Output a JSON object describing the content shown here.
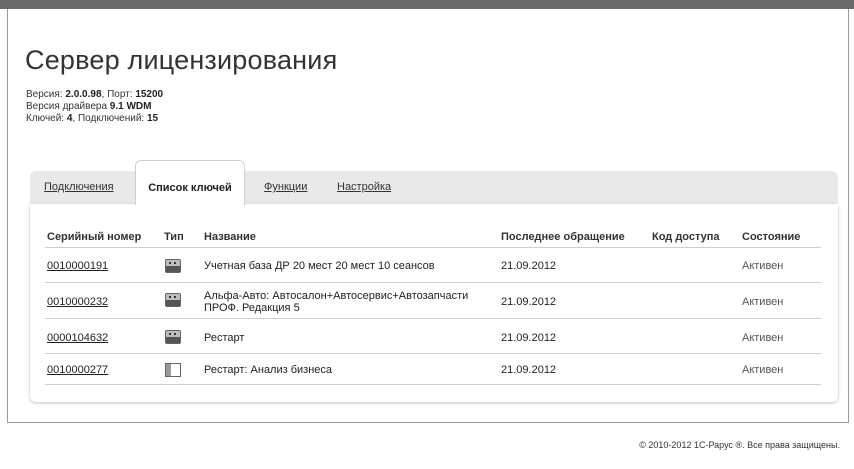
{
  "header": {
    "title": "Сервер лицензирования",
    "version_label": "Версия:",
    "version": "2.0.0.98",
    "port_label": ", Порт:",
    "port": "15200",
    "driver_label": "Версия драйвера",
    "driver": "9.1 WDM",
    "keys_label": "Ключей:",
    "keys": "4",
    "connections_label": ", Подключений:",
    "connections": "15"
  },
  "tabs": [
    {
      "label": "Подключения",
      "active": false
    },
    {
      "label": "Список ключей",
      "active": true
    },
    {
      "label": "Функции",
      "active": false
    },
    {
      "label": "Настройка",
      "active": false
    }
  ],
  "table": {
    "headers": [
      "Серийный номер",
      "Тип",
      "Название",
      "Последнее обращение",
      "Код доступа",
      "Состояние"
    ],
    "rows": [
      {
        "serial": "0010000191",
        "type_icon": "usb-key-icon",
        "name": "Учетная база ДР 20 мест 20 мест 10 сеансов",
        "name_line2": "",
        "last_access": "21.09.2012",
        "access_code": "",
        "status": "Активен"
      },
      {
        "serial": "0010000232",
        "type_icon": "usb-key-icon",
        "name": "Альфа-Авто: Автосалон+Автосервис+Автозапчасти",
        "name_line2": "ПРОФ. Редакция 5",
        "last_access": "21.09.2012",
        "access_code": "",
        "status": "Активен"
      },
      {
        "serial": "0000104632",
        "type_icon": "usb-key-icon",
        "name": "Рестарт",
        "name_line2": "",
        "last_access": "21.09.2012",
        "access_code": "",
        "status": "Активен"
      },
      {
        "serial": "0010000277",
        "type_icon": "software-key-icon",
        "name": "Рестарт: Анализ бизнеса",
        "name_line2": "",
        "last_access": "21.09.2012",
        "access_code": "",
        "status": "Активен"
      }
    ]
  },
  "footer": {
    "copyright": "© 2010-2012 1С-Рарус ®. Все права защищены."
  }
}
